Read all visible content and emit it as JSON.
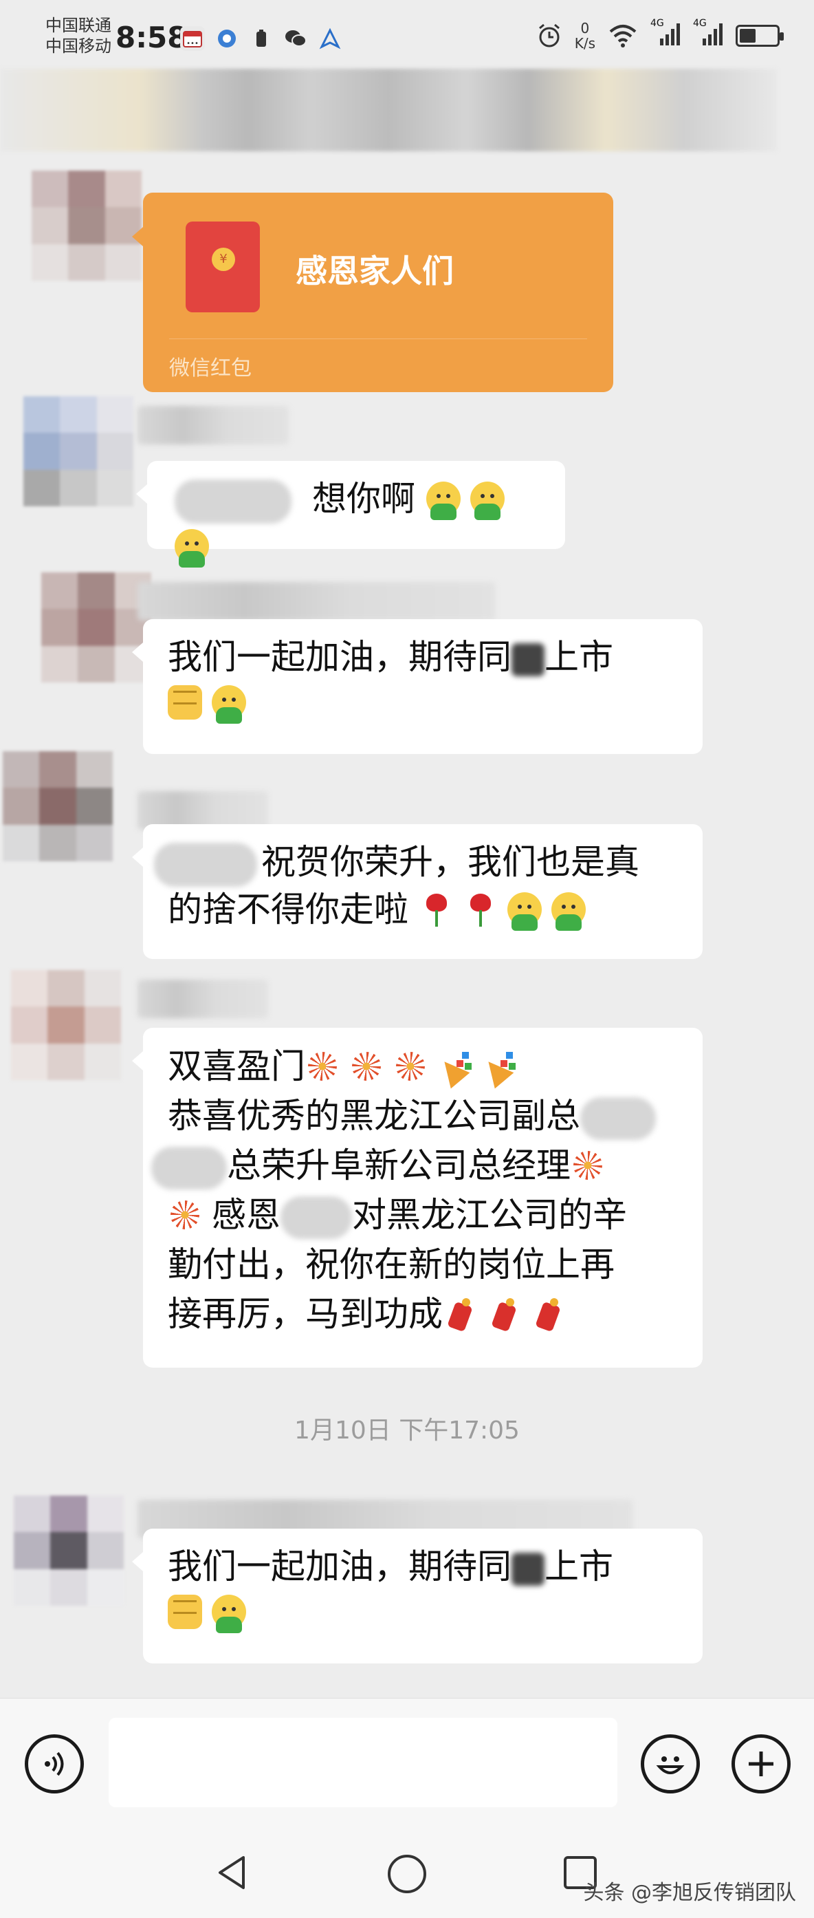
{
  "status_bar": {
    "carrier_1": "中国联通",
    "carrier_2": "中国移动",
    "time": "8:58",
    "net_speed_value": "0",
    "net_speed_unit": "K/s",
    "network_1": "4G",
    "network_2": "4G",
    "icons": [
      "calendar-icon",
      "app-icon",
      "battery-saver-icon",
      "wechat-icon",
      "map-icon",
      "alarm-icon",
      "wifi-icon",
      "signal-icon",
      "battery-icon"
    ]
  },
  "red_packet": {
    "title": "感恩家人们",
    "footer": "微信红包",
    "color": "#f1a045"
  },
  "messages": [
    {
      "id": "m1",
      "text": "想你啊"
    },
    {
      "id": "m2",
      "line1": "我们一起加油，期待同",
      "line1_end": "上市"
    },
    {
      "id": "m3",
      "line1": "祝贺你荣升，我们也是真",
      "line2": "的捨不得你走啦"
    },
    {
      "id": "m4",
      "line1": "双喜盈门",
      "line2": "恭喜优秀的黑龙江公司副总",
      "line3": "总荣升阜新公司总经理",
      "line4_a": "感恩",
      "line4_b": "对黑龙江公司的辛",
      "line5": "勤付出，祝你在新的岗位上再",
      "line6": "接再厉，马到功成"
    },
    {
      "id": "m5",
      "line1": "我们一起加油，期待同",
      "line1_end": "上市"
    }
  ],
  "timestamp": "1月10日 下午17:05",
  "input_bar": {
    "voice_icon": "voice-icon",
    "emoji_icon": "emoji-icon",
    "plus_icon": "plus-icon"
  },
  "nav_bar": {
    "back_icon": "back-icon",
    "home_icon": "home-icon",
    "recent_icon": "recent-icon"
  },
  "watermark": "头条 @李旭反传销团队"
}
